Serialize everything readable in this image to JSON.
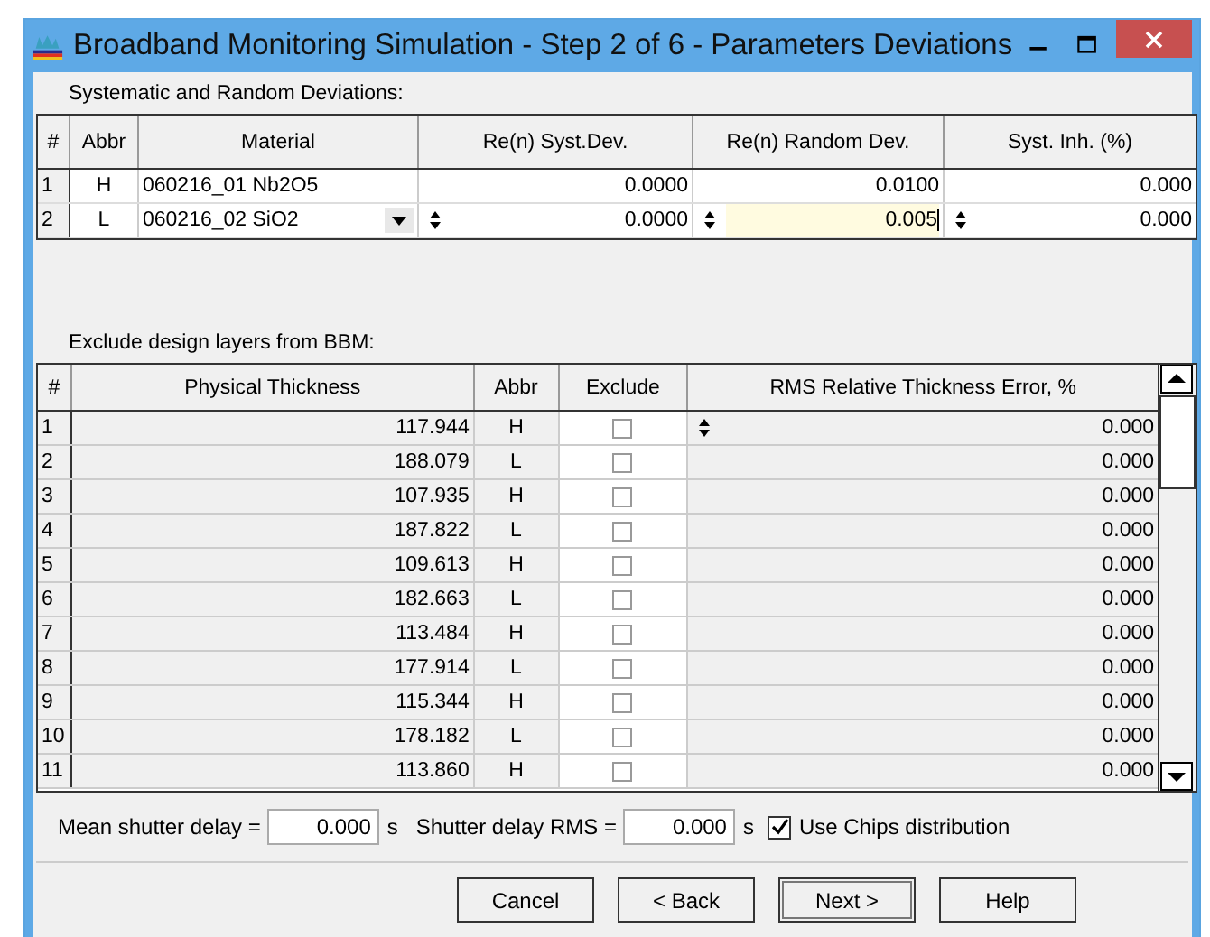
{
  "window": {
    "title": "Broadband Monitoring Simulation - Step 2 of 6 - Parameters Deviations"
  },
  "deviations": {
    "label": "Systematic and Random Deviations:",
    "columns": [
      "#",
      "Abbr",
      "Material",
      "Re(n) Syst.Dev.",
      "Re(n) Random Dev.",
      "Syst. Inh. (%)"
    ],
    "rows": [
      {
        "index": "1",
        "abbr": "H",
        "material": "060216_01 Nb2O5",
        "syst_dev": "0.0000",
        "random_dev": "0.0100",
        "syst_inh": "0.000",
        "editing": false,
        "random_focused": false
      },
      {
        "index": "2",
        "abbr": "L",
        "material": "060216_02 SiO2",
        "syst_dev": "0.0000",
        "random_dev": "0.005",
        "syst_inh": "0.000",
        "editing": true,
        "random_focused": true
      }
    ]
  },
  "layers": {
    "label": "Exclude design layers from BBM:",
    "columns": [
      "#",
      "Physical Thickness",
      "Abbr",
      "Exclude",
      "RMS Relative Thickness Error, %"
    ],
    "rows": [
      {
        "index": "1",
        "thickness": "117.944",
        "abbr": "H",
        "exclude": false,
        "rms": "0.000",
        "editing": true
      },
      {
        "index": "2",
        "thickness": "188.079",
        "abbr": "L",
        "exclude": false,
        "rms": "0.000",
        "editing": false
      },
      {
        "index": "3",
        "thickness": "107.935",
        "abbr": "H",
        "exclude": false,
        "rms": "0.000",
        "editing": false
      },
      {
        "index": "4",
        "thickness": "187.822",
        "abbr": "L",
        "exclude": false,
        "rms": "0.000",
        "editing": false
      },
      {
        "index": "5",
        "thickness": "109.613",
        "abbr": "H",
        "exclude": false,
        "rms": "0.000",
        "editing": false
      },
      {
        "index": "6",
        "thickness": "182.663",
        "abbr": "L",
        "exclude": false,
        "rms": "0.000",
        "editing": false
      },
      {
        "index": "7",
        "thickness": "113.484",
        "abbr": "H",
        "exclude": false,
        "rms": "0.000",
        "editing": false
      },
      {
        "index": "8",
        "thickness": "177.914",
        "abbr": "L",
        "exclude": false,
        "rms": "0.000",
        "editing": false
      },
      {
        "index": "9",
        "thickness": "115.344",
        "abbr": "H",
        "exclude": false,
        "rms": "0.000",
        "editing": false
      },
      {
        "index": "10",
        "thickness": "178.182",
        "abbr": "L",
        "exclude": false,
        "rms": "0.000",
        "editing": false
      },
      {
        "index": "11",
        "thickness": "113.860",
        "abbr": "H",
        "exclude": false,
        "rms": "0.000",
        "editing": false
      }
    ]
  },
  "shutter": {
    "mean_label": "Mean shutter delay =",
    "mean_value": "0.000",
    "mean_unit": "s",
    "rms_label": "Shutter delay RMS =",
    "rms_value": "0.000",
    "rms_unit": "s",
    "chips": {
      "label": "Use Chips distribution",
      "checked": true
    }
  },
  "buttons": [
    {
      "label": "Cancel",
      "default": false
    },
    {
      "label": "< Back",
      "default": false
    },
    {
      "label": "Next >",
      "default": true
    },
    {
      "label": "Help",
      "default": false
    }
  ]
}
